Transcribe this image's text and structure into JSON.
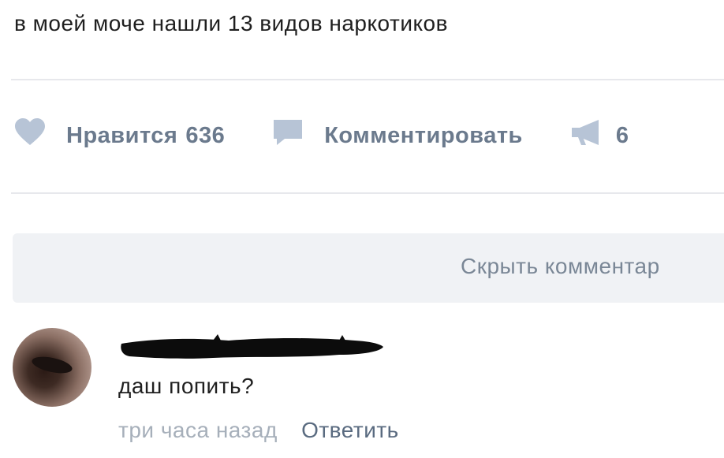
{
  "post": {
    "text": "в моей моче нашли 13 видов наркотиков"
  },
  "actions": {
    "like_label": "Нравится",
    "like_count": "636",
    "comment_label": "Комментировать",
    "share_count": "6"
  },
  "icons": {
    "like": "heart-icon",
    "comment": "speech-bubble-icon",
    "share": "megaphone-icon"
  },
  "colors": {
    "action_gray": "#6b7a8d",
    "icon_blue": "#b7c4d6",
    "hide_bar_bg": "#f0f2f5",
    "divider": "#e7e8ec"
  },
  "comments_toggle": {
    "label": "Скрыть комментар"
  },
  "comment": {
    "text": "даш попить?",
    "time": "три часа назад",
    "reply_label": "Ответить"
  }
}
